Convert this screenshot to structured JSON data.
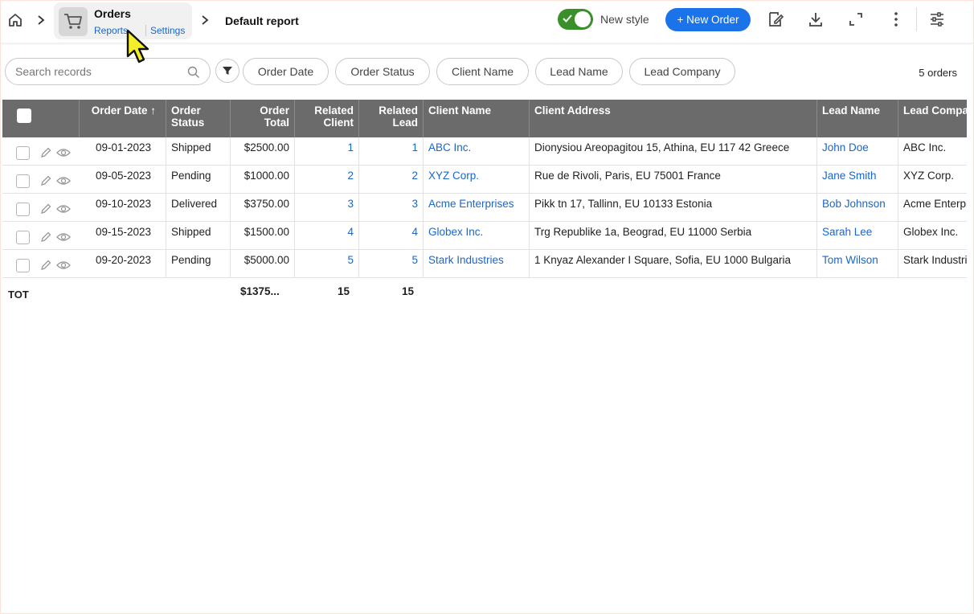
{
  "breadcrumb": {
    "app_name": "Orders",
    "reports_link": "Reports",
    "settings_link": "Settings",
    "report_title": "Default report"
  },
  "toolbar": {
    "new_style_label": "New style",
    "new_style_on": true,
    "new_order_label": "+ New Order"
  },
  "filters": {
    "search_placeholder": "Search records",
    "chips": [
      "Order Date",
      "Order Status",
      "Client Name",
      "Lead Name",
      "Lead Company"
    ],
    "count_label": "5 orders"
  },
  "table": {
    "columns": {
      "order_date": "Order Date",
      "order_status": "Order Status",
      "order_total": "Order Total",
      "related_client": "Related Client",
      "related_lead": "Related Lead",
      "client_name": "Client Name",
      "client_address": "Client Address",
      "lead_name": "Lead Name",
      "lead_company": "Lead Compa"
    },
    "sort_indicator": "↑",
    "rows": [
      {
        "date": "09-01-2023",
        "status": "Shipped",
        "total": "$2500.00",
        "client": "1",
        "lead": "1",
        "client_name": "ABC Inc.",
        "address": "Dionysiou Areopagitou 15, Athina, EU 117 42 Greece",
        "lead_name": "John Doe",
        "lead_company": "ABC Inc."
      },
      {
        "date": "09-05-2023",
        "status": "Pending",
        "total": "$1000.00",
        "client": "2",
        "lead": "2",
        "client_name": "XYZ Corp.",
        "address": "Rue de Rivoli, Paris, EU 75001 France",
        "lead_name": "Jane Smith",
        "lead_company": "XYZ Corp."
      },
      {
        "date": "09-10-2023",
        "status": "Delivered",
        "total": "$3750.00",
        "client": "3",
        "lead": "3",
        "client_name": "Acme Enterprises",
        "address": "Pikk tn 17, Tallinn, EU 10133 Estonia",
        "lead_name": "Bob Johnson",
        "lead_company": "Acme Enterpr"
      },
      {
        "date": "09-15-2023",
        "status": "Shipped",
        "total": "$1500.00",
        "client": "4",
        "lead": "4",
        "client_name": "Globex Inc.",
        "address": "Trg Republike 1a, Beograd, EU 11000 Serbia",
        "lead_name": "Sarah Lee",
        "lead_company": "Globex Inc."
      },
      {
        "date": "09-20-2023",
        "status": "Pending",
        "total": "$5000.00",
        "client": "5",
        "lead": "5",
        "client_name": "Stark Industries",
        "address": "1 Knyaz Alexander I Square, Sofia, EU 1000 Bulgaria",
        "lead_name": "Tom Wilson",
        "lead_company": "Stark Industri"
      }
    ],
    "totals": {
      "label": "TOT",
      "order_total": "$1375...",
      "related_client": "15",
      "related_lead": "15"
    }
  },
  "colors": {
    "accent": "#1a73e8",
    "link": "#1a66c9",
    "toggle_on": "#3b8f2a",
    "header_bg": "#6b6b6b"
  }
}
